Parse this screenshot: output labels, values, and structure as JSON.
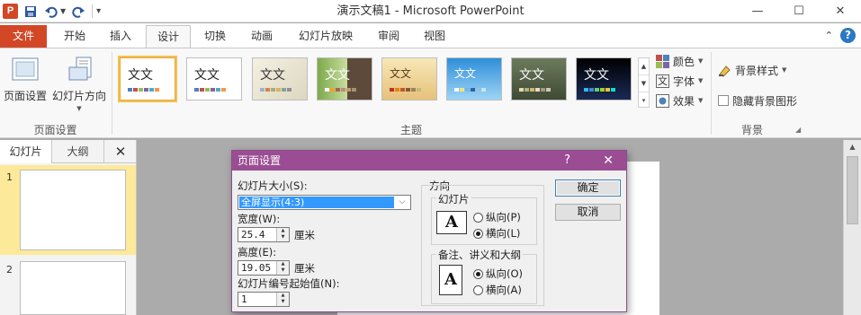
{
  "app": {
    "window_title": "演示文稿1 - Microsoft PowerPoint",
    "logo_letter": "P"
  },
  "ribbon_tabs": {
    "file": "文件",
    "tabs": [
      "开始",
      "插入",
      "设计",
      "切换",
      "动画",
      "幻灯片放映",
      "审阅",
      "视图"
    ],
    "active_index": 2
  },
  "ribbon": {
    "page_setup": {
      "group_label": "页面设置",
      "page_setup_btn": "页面设置",
      "orientation_btn": "幻灯片方向"
    },
    "themes": {
      "group_label": "主题",
      "sample_text": "文文",
      "thumb_colors": [
        "#ffffff",
        "#ffffff",
        "#efeadb",
        "#a7c77a",
        "#f1e0b0",
        "#4aa3df",
        "#7b8c6a",
        "#111111"
      ],
      "colors_label": "颜色",
      "fonts_label": "字体",
      "effects_label": "效果"
    },
    "background": {
      "group_label": "背景",
      "bg_styles_label": "背景样式",
      "hide_bg_label": "隐藏背景图形"
    }
  },
  "slide_pane": {
    "tab_slides": "幻灯片",
    "tab_outline": "大纲",
    "close": "✕",
    "slides": [
      "1",
      "2"
    ]
  },
  "dialog": {
    "title": "页面设置",
    "help": "?",
    "close": "✕",
    "slide_size_label": "幻灯片大小(S):",
    "slide_size_value": "全屏显示(4:3)",
    "width_label": "宽度(W):",
    "width_value": "25.4",
    "height_label": "高度(E):",
    "height_value": "19.05",
    "unit": "厘米",
    "start_number_label": "幻灯片编号起始值(N):",
    "start_number_value": "1",
    "orientation_label": "方向",
    "slides_group": "幻灯片",
    "slides_portrait": "纵向(P)",
    "slides_landscape": "横向(L)",
    "notes_group": "备注、讲义和大纲",
    "notes_portrait": "纵向(O)",
    "notes_landscape": "横向(A)",
    "icon_letter": "A",
    "ok": "确定",
    "cancel": "取消"
  }
}
